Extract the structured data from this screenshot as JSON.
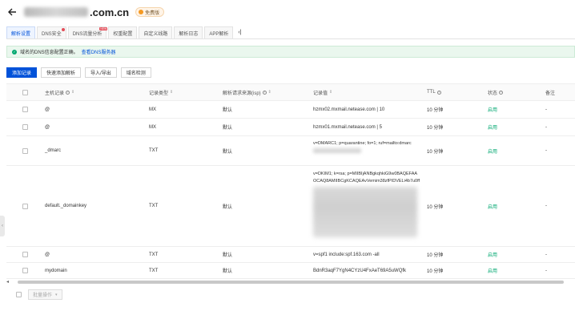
{
  "header": {
    "domain_suffix": ".com.cn",
    "badge_label": "免费版"
  },
  "tabs": [
    {
      "label": "解析设置",
      "active": true
    },
    {
      "label": "DNS安全",
      "dot": true
    },
    {
      "label": "DNS流量分析",
      "tag": "NEW"
    },
    {
      "label": "权重配置"
    },
    {
      "label": "自定义线路"
    },
    {
      "label": "解析日志"
    },
    {
      "label": "APP解析"
    }
  ],
  "tab_collapse_glyph": "‹|",
  "notice": {
    "text": "域名的DNS信息配置正确。",
    "link": "查看DNS服务器"
  },
  "toolbar": {
    "add": "添加记录",
    "quick_add": "快速添加解析",
    "import_export": "导入/导出",
    "check": "域名检测"
  },
  "table": {
    "headers": {
      "host": "主机记录",
      "type": "记录类型",
      "line": "解析请求来源(isp)",
      "value": "记录值",
      "ttl": "TTL",
      "status": "状态",
      "remark": "备注"
    },
    "rows": [
      {
        "host": "@",
        "type": "MX",
        "line": "默认",
        "value": "hzmx02.mxmail.netease.com | 10",
        "ttl": "10 分钟",
        "status": "启用",
        "remark": "-"
      },
      {
        "host": "@",
        "type": "MX",
        "line": "默认",
        "value": "hzmx01.mxmail.netease.com | 5",
        "ttl": "10 分钟",
        "status": "启用",
        "remark": "-"
      },
      {
        "host": "_dmarc",
        "type": "TXT",
        "line": "默认",
        "value": "v=DMARC1; p=quarantine; fo=1; ruf=mailto:dmarc",
        "ttl": "10 分钟",
        "status": "启用",
        "remark": "-"
      },
      {
        "host": "default._domainkey",
        "type": "TXT",
        "line": "默认",
        "value_lines": [
          "v=DKIM1; k=rsa; p=MIIBIjANBgkqhkiG9w0BAQEFAA",
          "OCAQ8AMIIBCgKCAQEAvVemim38zfPIDVELi4b7u0ff"
        ],
        "ttl": "10 分钟",
        "status": "启用",
        "remark": "-"
      },
      {
        "host": "@",
        "type": "TXT",
        "line": "默认",
        "value": "v=spf1 include:spf.163.com -all",
        "ttl": "10 分钟",
        "status": "启用",
        "remark": "-"
      },
      {
        "host": "mydomain",
        "type": "TXT",
        "line": "默认",
        "value": "BdnR3aqF7YgN4CYzU4FxAeT69A5uWQfk",
        "ttl": "10 分钟",
        "status": "启用",
        "remark": "-"
      }
    ]
  },
  "footer": {
    "batch_label": "批量操作"
  },
  "colors": {
    "primary": "#0052d9",
    "success": "#00a870",
    "badge": "#f59a23"
  },
  "icons": [
    "back-arrow-icon",
    "badge-dot-icon",
    "check-circle-icon",
    "help-circle-icon",
    "sort-icon",
    "chevron-left-icon",
    "chevron-down-icon"
  ]
}
